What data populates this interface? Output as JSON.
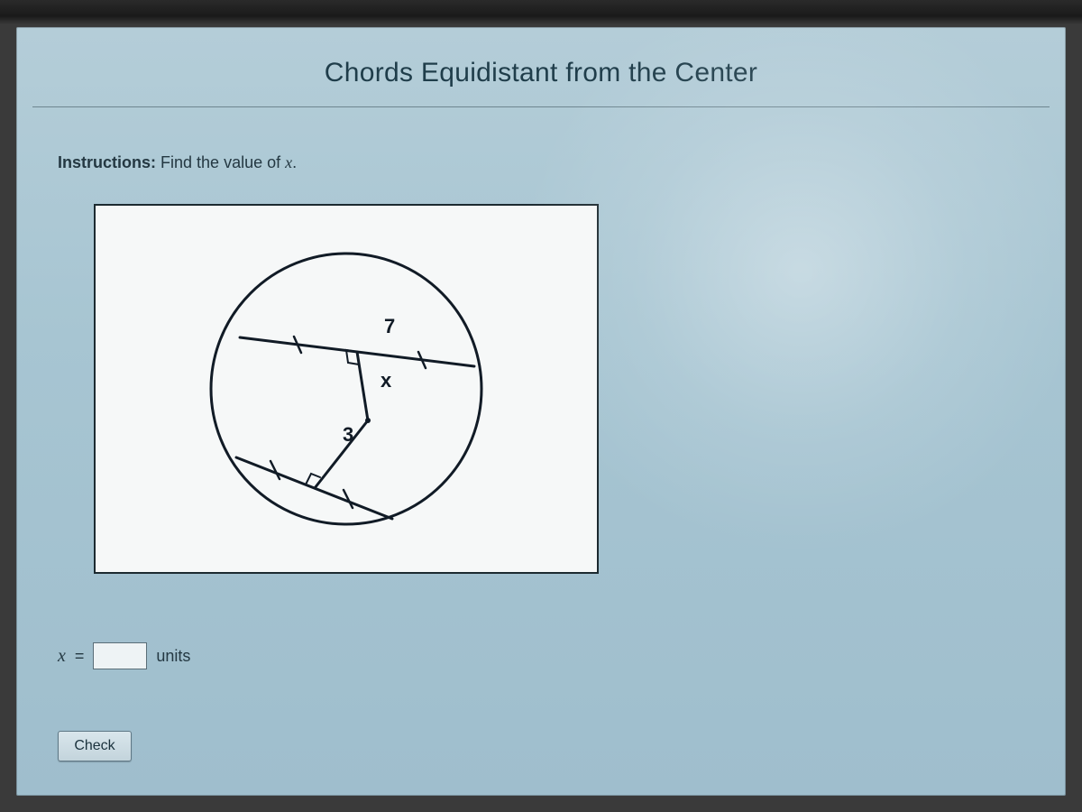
{
  "header": {
    "title": "Chords Equidistant from the Center"
  },
  "instructions": {
    "label_prefix": "Instructions:",
    "text": "Find the value of",
    "variable": "x",
    "suffix": "."
  },
  "figure": {
    "segment_label_half": "7",
    "perpendicular_label": "x",
    "other_perpendicular_label": "3"
  },
  "answer": {
    "variable": "x",
    "equals": "=",
    "value": "",
    "units_label": "units"
  },
  "controls": {
    "check_label": "Check"
  }
}
